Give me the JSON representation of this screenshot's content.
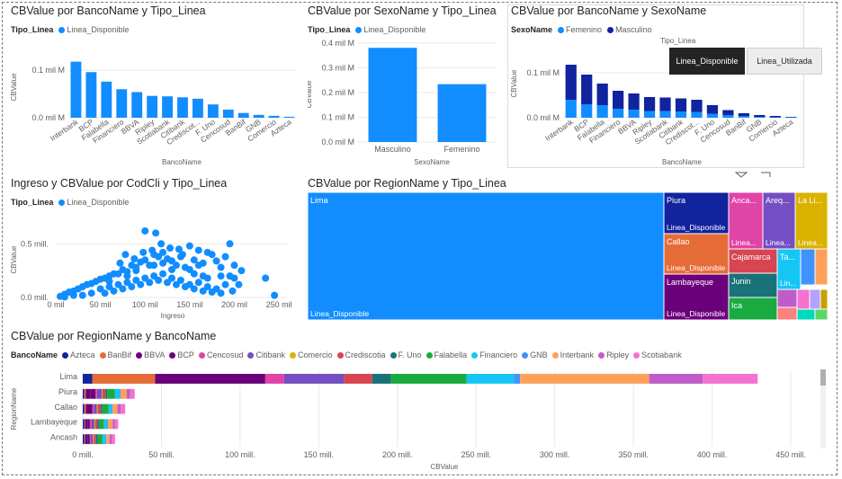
{
  "colors": {
    "linea_disponible": "#118DFF",
    "femenino": "#118DFF",
    "masculino": "#12239E",
    "axis_text": "#605e5c",
    "grid": "#e8e8e8"
  },
  "chart_data": [
    {
      "id": "banco_tipo",
      "type": "bar",
      "title": "CBValue por BancoName y Tipo_Linea",
      "legend_title": "Tipo_Linea",
      "xlabel": "BancoName",
      "ylabel": "CBValue",
      "yticks": [
        "0.0 mil M",
        "0.1 mil M"
      ],
      "ytick_values": [
        0,
        0.1
      ],
      "ylim": [
        0,
        0.14
      ],
      "categories": [
        "Interbank",
        "BCP",
        "Falabella",
        "Financiero",
        "BBVA",
        "Ripley",
        "Scotiabank",
        "Citibank",
        "Crediscot...",
        "F. Uno",
        "Cencosud",
        "BanBif",
        "GNB",
        "Comercio",
        "Azteca"
      ],
      "series": [
        {
          "name": "Linea_Disponible",
          "values": [
            0.118,
            0.096,
            0.076,
            0.06,
            0.054,
            0.046,
            0.045,
            0.043,
            0.04,
            0.028,
            0.017,
            0.01,
            0.006,
            0.004,
            0.002
          ]
        }
      ]
    },
    {
      "id": "sexo_tipo",
      "type": "bar",
      "title": "CBValue por SexoName y Tipo_Linea",
      "legend_title": "Tipo_Linea",
      "xlabel": "SexoName",
      "ylabel": "CBValue",
      "yticks": [
        "0.0 mil M",
        "0.1 mil M",
        "0.2 mil M",
        "0.3 mil M",
        "0.4 mil M"
      ],
      "ytick_values": [
        0,
        0.1,
        0.2,
        0.3,
        0.4
      ],
      "ylim": [
        0,
        0.4
      ],
      "categories": [
        "Masculino",
        "Femenino"
      ],
      "series": [
        {
          "name": "Linea_Disponible",
          "values": [
            0.381,
            0.234
          ]
        }
      ]
    },
    {
      "id": "banco_sexo",
      "type": "bar",
      "stacked": true,
      "title": "CBValue por BancoName y SexoName",
      "legend_title": "SexoName",
      "xlabel": "BancoName",
      "ylabel": "CBValue",
      "yticks": [
        "0.0 mil M",
        "0.1 mil M"
      ],
      "ytick_values": [
        0,
        0.1
      ],
      "ylim": [
        0,
        0.14
      ],
      "categories": [
        "Interbank",
        "BCP",
        "Falabella",
        "Financiero",
        "BBVA",
        "Ripley",
        "Scotiabank",
        "Citibank",
        "Crediscot...",
        "F. Uno",
        "Cencosud",
        "BanBif",
        "GNB",
        "Comercio",
        "Azteca"
      ],
      "series": [
        {
          "name": "Femenino",
          "values": [
            0.04,
            0.03,
            0.028,
            0.02,
            0.018,
            0.015,
            0.015,
            0.014,
            0.013,
            0.009,
            0.006,
            0.004,
            0.002,
            0.001,
            0.001
          ]
        },
        {
          "name": "Masculino",
          "values": [
            0.078,
            0.066,
            0.048,
            0.04,
            0.036,
            0.031,
            0.03,
            0.029,
            0.027,
            0.019,
            0.011,
            0.006,
            0.004,
            0.003,
            0.001
          ]
        }
      ]
    },
    {
      "id": "ingreso_scatter",
      "type": "scatter",
      "title": "Ingreso y CBValue por CodCli y Tipo_Linea",
      "legend_title": "Tipo_Linea",
      "xlabel": "Ingreso",
      "ylabel": "CBValue",
      "xticks": [
        "0 mil",
        "50 mil",
        "100 mil",
        "150 mil",
        "200 mil",
        "250 mil"
      ],
      "xtick_values": [
        0,
        50,
        100,
        150,
        200,
        250
      ],
      "yticks": [
        "0.0 mill.",
        "0.5 mill."
      ],
      "ytick_values": [
        0,
        0.5
      ],
      "xlim": [
        0,
        260
      ],
      "ylim": [
        0,
        0.72
      ],
      "series": [
        {
          "name": "Linea_Disponible",
          "points": [
            [
              5,
              0.01
            ],
            [
              10,
              0.03
            ],
            [
              15,
              0.05
            ],
            [
              20,
              0.06
            ],
            [
              25,
              0.08
            ],
            [
              30,
              0.1
            ],
            [
              35,
              0.12
            ],
            [
              40,
              0.13
            ],
            [
              45,
              0.15
            ],
            [
              50,
              0.17
            ],
            [
              55,
              0.18
            ],
            [
              60,
              0.2
            ],
            [
              65,
              0.22
            ],
            [
              70,
              0.22
            ],
            [
              75,
              0.26
            ],
            [
              80,
              0.24
            ],
            [
              85,
              0.3
            ],
            [
              90,
              0.28
            ],
            [
              95,
              0.33
            ],
            [
              100,
              0.35
            ],
            [
              105,
              0.3
            ],
            [
              110,
              0.4
            ],
            [
              115,
              0.38
            ],
            [
              120,
              0.42
            ],
            [
              125,
              0.36
            ],
            [
              130,
              0.34
            ],
            [
              135,
              0.3
            ],
            [
              140,
              0.38
            ],
            [
              145,
              0.28
            ],
            [
              150,
              0.26
            ],
            [
              155,
              0.22
            ],
            [
              160,
              0.3
            ],
            [
              165,
              0.2
            ],
            [
              170,
              0.18
            ],
            [
              180,
              0.34
            ],
            [
              185,
              0.2
            ],
            [
              195,
              0.5
            ],
            [
              200,
              0.3
            ],
            [
              205,
              0.12
            ],
            [
              235,
              0.18
            ],
            [
              100,
              0.62
            ],
            [
              112,
              0.6
            ],
            [
              138,
              0.45
            ],
            [
              150,
              0.48
            ],
            [
              160,
              0.44
            ],
            [
              170,
              0.42
            ],
            [
              175,
              0.4
            ],
            [
              190,
              0.38
            ],
            [
              198,
              0.06
            ],
            [
              245,
              0.02
            ],
            [
              60,
              0.1
            ],
            [
              70,
              0.12
            ],
            [
              80,
              0.14
            ],
            [
              90,
              0.16
            ],
            [
              100,
              0.18
            ],
            [
              110,
              0.2
            ],
            [
              120,
              0.22
            ],
            [
              130,
              0.18
            ],
            [
              140,
              0.16
            ],
            [
              55,
              0.04
            ],
            [
              65,
              0.06
            ],
            [
              75,
              0.08
            ],
            [
              85,
              0.1
            ],
            [
              95,
              0.12
            ],
            [
              105,
              0.14
            ],
            [
              115,
              0.16
            ],
            [
              125,
              0.14
            ],
            [
              135,
              0.12
            ],
            [
              145,
              0.1
            ],
            [
              155,
              0.08
            ],
            [
              165,
              0.06
            ],
            [
              175,
              0.05
            ],
            [
              185,
              0.04
            ],
            [
              30,
              0.02
            ],
            [
              40,
              0.04
            ],
            [
              20,
              0.02
            ],
            [
              10,
              0.005
            ],
            [
              50,
              0.08
            ],
            [
              60,
              0.15
            ],
            [
              80,
              0.2
            ],
            [
              90,
              0.25
            ],
            [
              110,
              0.3
            ],
            [
              120,
              0.32
            ],
            [
              130,
              0.26
            ],
            [
              150,
              0.12
            ],
            [
              160,
              0.14
            ],
            [
              170,
              0.1
            ],
            [
              180,
              0.08
            ],
            [
              190,
              0.12
            ],
            [
              195,
              0.2
            ],
            [
              200,
              0.18
            ],
            [
              208,
              0.25
            ],
            [
              118,
              0.5
            ],
            [
              128,
              0.46
            ],
            [
              108,
              0.44
            ],
            [
              142,
              0.4
            ],
            [
              155,
              0.35
            ],
            [
              165,
              0.32
            ],
            [
              185,
              0.28
            ],
            [
              78,
              0.4
            ],
            [
              88,
              0.36
            ],
            [
              98,
              0.42
            ],
            [
              72,
              0.32
            ]
          ]
        }
      ]
    },
    {
      "id": "region_treemap",
      "type": "treemap",
      "title": "CBValue por RegionName y Tipo_Linea",
      "items": [
        {
          "label": "Lima",
          "sublabel": "Linea_Disponible",
          "value": 100,
          "color": "#118DFF"
        },
        {
          "label": "Piura",
          "sublabel": "Linea_Disponible",
          "value": 9,
          "color": "#12239E"
        },
        {
          "label": "Callao",
          "sublabel": "Linea_Disponible",
          "value": 8,
          "color": "#E66C37"
        },
        {
          "label": "Lambayeque",
          "sublabel": "Linea_Disponible",
          "value": 7,
          "color": "#6B007B"
        },
        {
          "label": "Anca...",
          "sublabel": "Linea...",
          "value": 5,
          "color": "#E044A7"
        },
        {
          "label": "Areq...",
          "sublabel": "Linea...",
          "value": 5,
          "color": "#744EC2"
        },
        {
          "label": "La Li...",
          "sublabel": "Linea...",
          "value": 5,
          "color": "#D9B300"
        },
        {
          "label": "Cajamarca",
          "sublabel": "",
          "value": 3,
          "color": "#D64550"
        },
        {
          "label": "Junin",
          "sublabel": "",
          "value": 2.5,
          "color": "#197278"
        },
        {
          "label": "Ica",
          "sublabel": "",
          "value": 2.5,
          "color": "#1AAB40"
        },
        {
          "label": "Ta...",
          "sublabel": "Lin...",
          "value": 2,
          "color": "#15C6F4"
        },
        {
          "label": "",
          "sublabel": "",
          "value": 1,
          "color": "#4092FF"
        },
        {
          "label": "",
          "sublabel": "",
          "value": 1,
          "color": "#FFA058"
        },
        {
          "label": "",
          "sublabel": "",
          "value": 1,
          "color": "#BE5DC9"
        },
        {
          "label": "",
          "sublabel": "",
          "value": 1,
          "color": "#F472D0"
        },
        {
          "label": "",
          "sublabel": "",
          "value": 0.8,
          "color": "#B5A1FF"
        },
        {
          "label": "",
          "sublabel": "",
          "value": 0.8,
          "color": "#C4A200"
        },
        {
          "label": "",
          "sublabel": "",
          "value": 0.6,
          "color": "#FF8080"
        },
        {
          "label": "",
          "sublabel": "",
          "value": 0.5,
          "color": "#00DBBC"
        },
        {
          "label": "",
          "sublabel": "",
          "value": 0.5,
          "color": "#5BD667"
        }
      ]
    },
    {
      "id": "region_banco",
      "type": "bar",
      "orientation": "horizontal",
      "stacked": true,
      "title": "CBValue por RegionName y BancoName",
      "legend_title": "BancoName",
      "xlabel": "CBValue",
      "ylabel": "RegionName",
      "xticks": [
        "0 mill.",
        "50 mill.",
        "100 mill.",
        "150 mill.",
        "200 mill.",
        "250 mill.",
        "300 mill.",
        "350 mill.",
        "400 mill.",
        "450 mill."
      ],
      "xtick_values": [
        0,
        50,
        100,
        150,
        200,
        250,
        300,
        350,
        400,
        450
      ],
      "xlim": [
        0,
        462
      ],
      "categories": [
        "Lima",
        "Piura",
        "Callao",
        "Lambayeque",
        "Ancash"
      ],
      "series": [
        {
          "name": "Azteca",
          "color": "#12239E",
          "values": [
            6,
            1,
            1,
            1,
            1
          ]
        },
        {
          "name": "BanBif",
          "color": "#E66C37",
          "values": [
            40,
            1,
            1,
            0.5,
            0.5
          ]
        },
        {
          "name": "BBVA",
          "color": "#6B007B",
          "values": [
            70,
            3,
            2,
            1.5,
            1.5
          ]
        },
        {
          "name": "BCP",
          "color": "#6B007B",
          "values": [
            0,
            3,
            2,
            1.5,
            1.5
          ]
        },
        {
          "name": "Cencosud",
          "color": "#E044A7",
          "values": [
            12,
            1,
            1,
            1,
            0.5
          ]
        },
        {
          "name": "Citibank",
          "color": "#744EC2",
          "values": [
            38,
            3,
            2,
            2,
            1.5
          ]
        },
        {
          "name": "Comercio",
          "color": "#D9B300",
          "values": [
            0,
            0.5,
            0.5,
            0.5,
            0.5
          ]
        },
        {
          "name": "Crediscotia",
          "color": "#D64550",
          "values": [
            18,
            2,
            2,
            1.5,
            1.5
          ]
        },
        {
          "name": "F. Uno",
          "color": "#197278",
          "values": [
            12,
            1,
            1,
            1,
            1
          ]
        },
        {
          "name": "Falabella",
          "color": "#1AAB40",
          "values": [
            48,
            5,
            4,
            3,
            3
          ]
        },
        {
          "name": "Financiero",
          "color": "#15C6F4",
          "values": [
            30,
            3,
            2,
            2,
            2
          ]
        },
        {
          "name": "GNB",
          "color": "#4092FF",
          "values": [
            4,
            0.5,
            0.5,
            0.5,
            0.5
          ]
        },
        {
          "name": "Interbank",
          "color": "#FFA058",
          "values": [
            82,
            4,
            3,
            3,
            2
          ]
        },
        {
          "name": "Ripley",
          "color": "#BE5DC9",
          "values": [
            34,
            2,
            2,
            1.5,
            1.5
          ]
        },
        {
          "name": "Scotiabank",
          "color": "#F472D0",
          "values": [
            35,
            3,
            3,
            2,
            2
          ]
        }
      ]
    }
  ],
  "slicer": {
    "title": "Tipo_Linea",
    "options": [
      {
        "label": "Linea_Disponible",
        "selected": true
      },
      {
        "label": "Linea_Utilizada",
        "selected": false
      }
    ]
  }
}
